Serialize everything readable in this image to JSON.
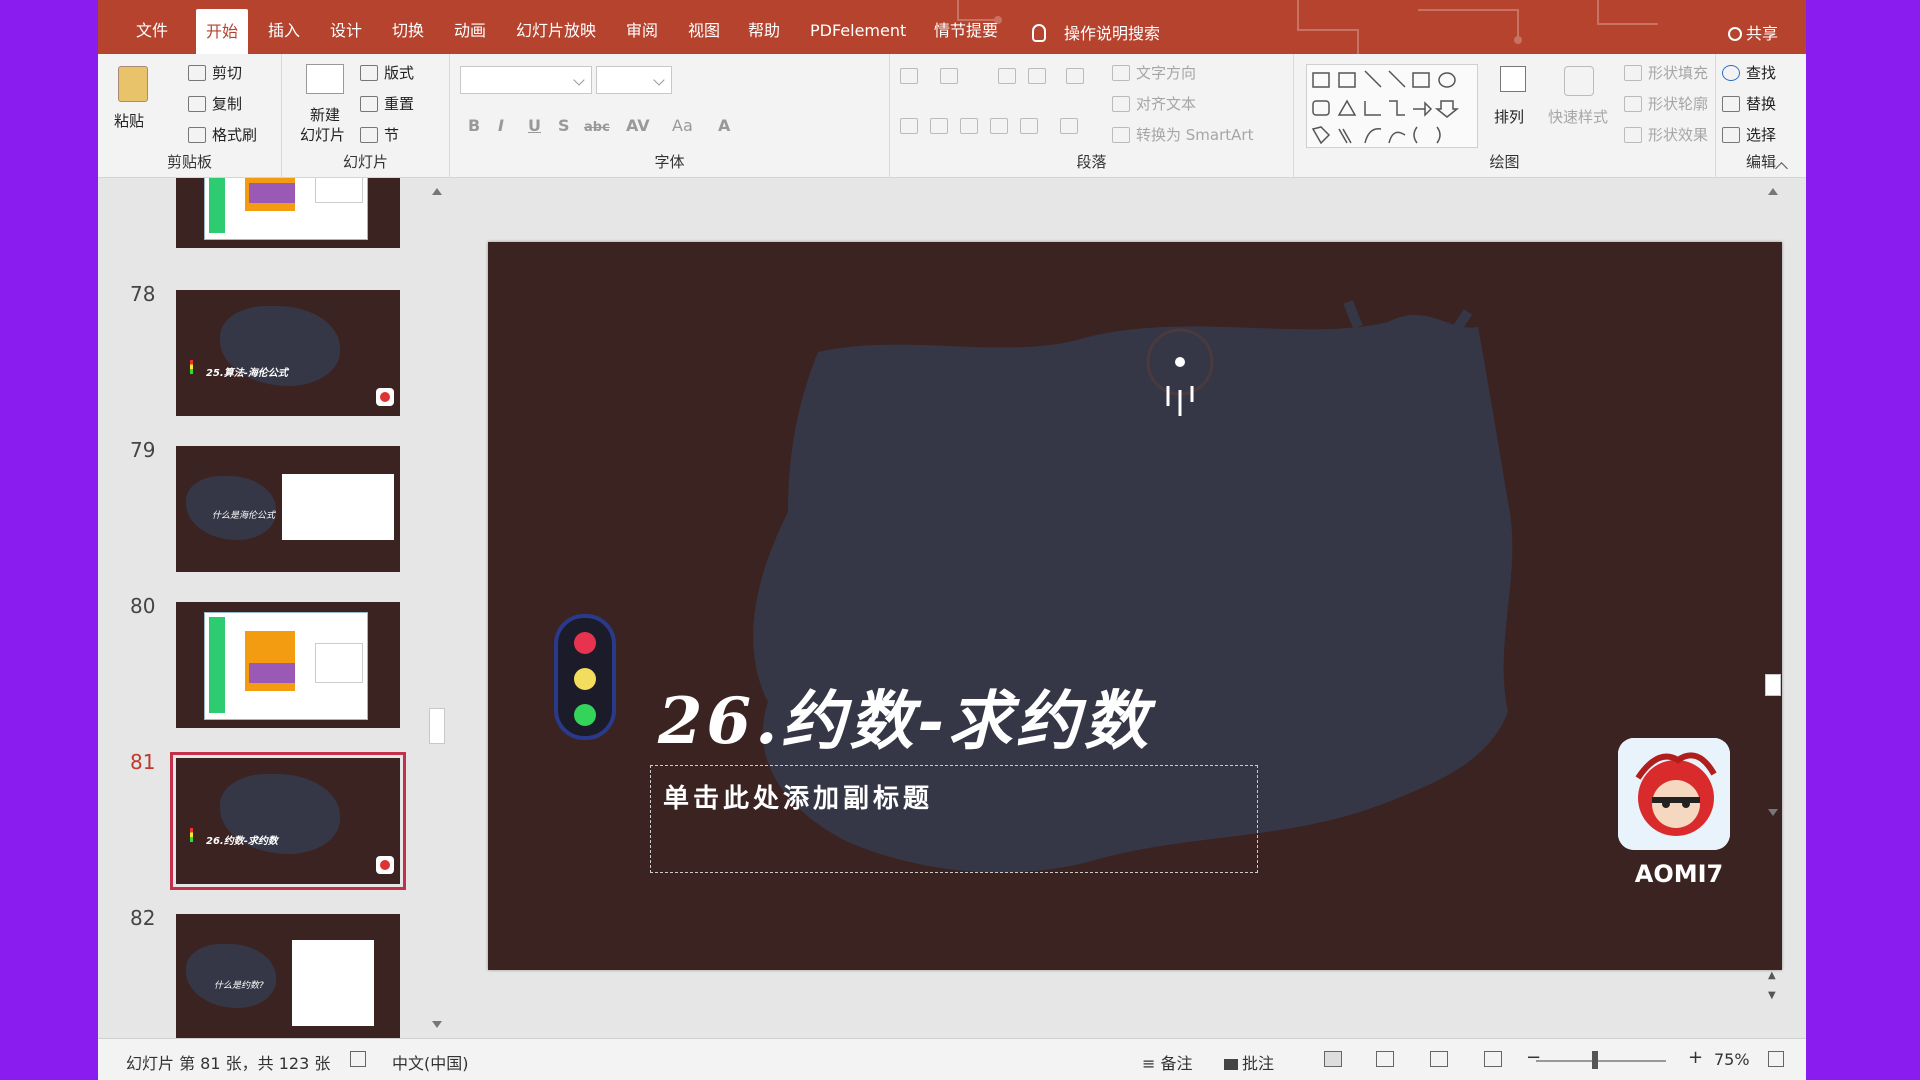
{
  "menu": {
    "tabs": [
      "文件",
      "开始",
      "插入",
      "设计",
      "切换",
      "动画",
      "幻灯片放映",
      "审阅",
      "视图",
      "帮助",
      "PDFelement",
      "情节提要"
    ],
    "active_index": 1,
    "tell_me": "操作说明搜索",
    "share": "共享"
  },
  "ribbon": {
    "clipboard": {
      "paste": "粘贴",
      "cut": "剪切",
      "copy": "复制",
      "format_painter": "格式刷",
      "label": "剪贴板"
    },
    "slides": {
      "new_slide_1": "新建",
      "new_slide_2": "幻灯片",
      "layout": "版式",
      "reset": "重置",
      "section": "节",
      "label": "幻灯片"
    },
    "font": {
      "label": "字体",
      "bold": "B",
      "italic": "I",
      "underline": "U",
      "shadow": "S",
      "strike": "abc",
      "spacing": "AV",
      "case": "Aa",
      "color": "A"
    },
    "paragraph": {
      "label": "段落",
      "text_direction": "文字方向",
      "align_text": "对齐文本",
      "smartart": "转换为 SmartArt"
    },
    "drawing": {
      "label": "绘图",
      "arrange": "排列",
      "quick_styles": "快速样式",
      "shape_fill": "形状填充",
      "shape_outline": "形状轮廓",
      "shape_effects": "形状效果"
    },
    "editing": {
      "label": "编辑",
      "find": "查找",
      "replace": "替换",
      "select": "选择"
    }
  },
  "thumbnails": [
    {
      "num": "",
      "kind": "screen"
    },
    {
      "num": "78",
      "kind": "title",
      "title": "25.算法-海伦公式"
    },
    {
      "num": "79",
      "kind": "card",
      "title": "什么是海伦公式"
    },
    {
      "num": "80",
      "kind": "screen"
    },
    {
      "num": "81",
      "kind": "title",
      "title": "26.约数-求约数",
      "active": true
    },
    {
      "num": "82",
      "kind": "card2",
      "title": "什么是约数?"
    }
  ],
  "slide": {
    "title": "26.约数-求约数",
    "subtitle_placeholder": "单击此处添加副标题",
    "logo_text": "AOMI7",
    "background": "#3b2322",
    "brush_color": "#363746",
    "lights": [
      "#e8334f",
      "#f2dd5c",
      "#34d35a"
    ]
  },
  "status": {
    "slide_info": "幻灯片 第 81 张，共 123 张",
    "language": "中文(中国)",
    "notes": "备注",
    "comments": "批注",
    "zoom_minus": "−",
    "zoom_plus": "+",
    "zoom": "75%"
  },
  "colors": {
    "accent": "#b5432e",
    "outer": "#8a1cf0"
  }
}
